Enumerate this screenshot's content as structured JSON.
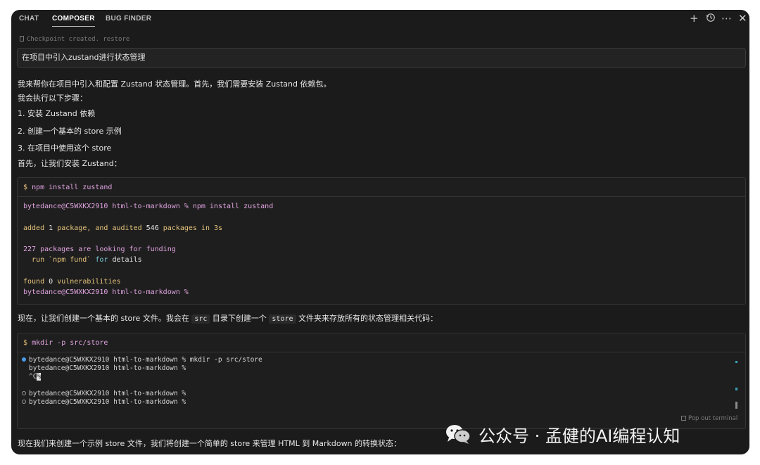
{
  "tabs": [
    {
      "label": "CHAT",
      "active": false
    },
    {
      "label": "COMPOSER",
      "active": true
    },
    {
      "label": "BUG FINDER",
      "active": false
    }
  ],
  "top_icons": [
    "plus-icon",
    "history-icon",
    "more-icon",
    "close-icon"
  ],
  "checkpoint": {
    "text": "Checkpoint created.",
    "action": "restore"
  },
  "prompt": "在项目中引入zustand进行状态管理",
  "message": {
    "intro": "我来帮你在项目中引入和配置 Zustand 状态管理。首先，我们需要安装 Zustand 依赖包。",
    "steps_intro": "我会执行以下步骤：",
    "steps": [
      "1. 安装 Zustand 依赖",
      "2. 创建一个基本的 store 示例",
      "3. 在项目中使用这个 store"
    ],
    "install_intro": "首先，让我们安装 Zustand：",
    "mkdir_intro_a": "现在，让我们创建一个基本的 store 文件。我会在",
    "mkdir_code_1": "src",
    "mkdir_intro_b": "目录下创建一个",
    "mkdir_code_2": "store",
    "mkdir_intro_c": "文件夹来存放所有的状态管理相关代码：",
    "final": "现在我们来创建一个示例 store 文件，我们将创建一个简单的 store 来管理 HTML 到 Markdown 的转换状态："
  },
  "command1": {
    "dollar": "$",
    "cmd": "npm install zustand",
    "output": {
      "prompt_line": "bytedance@C5WXKX2910 html-to-markdown % npm install zustand",
      "added_a": "added",
      "added_n1": "1",
      "added_b": "package, and audited",
      "added_n2": "546",
      "added_c": "packages in 3s",
      "funding_a": "227 packages are looking for funding",
      "funding_run": "run `npm fund`",
      "funding_for": "for",
      "funding_details": "details",
      "found_a": "found",
      "found_n": "0",
      "found_b": "vulnerabilities",
      "final_prompt": "bytedance@C5WXKX2910 html-to-markdown %"
    }
  },
  "command2": {
    "dollar": "$",
    "cmd": "mkdir -p src/store",
    "lines": [
      "bytedance@C5WXKX2910 html-to-markdown % mkdir -p src/store",
      "bytedance@C5WXKX2910 html-to-markdown %",
      "^C",
      "%",
      "bytedance@C5WXKX2910 html-to-markdown %",
      "bytedance@C5WXKX2910 html-to-markdown %"
    ],
    "popout": "Pop out terminal"
  },
  "watermark": "公众号 · 孟健的AI编程认知",
  "colors": {
    "background": "#1b1b1b",
    "accent_blue": "#4a9be8",
    "terminal_pink": "#e0a4e0",
    "terminal_yellow": "#e6c47c"
  }
}
